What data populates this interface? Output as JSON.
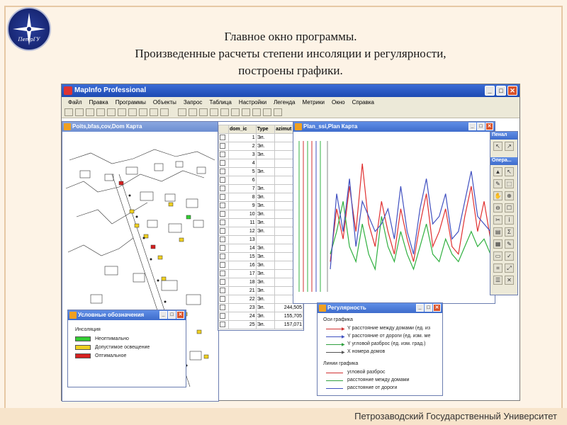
{
  "slide": {
    "title_line1": "Главное окно программы.",
    "title_line2": "Произведенные расчеты степени инсоляции и регулярности,",
    "title_line3": "построены графики.",
    "footer": "Петрозаводский Государственный Университет",
    "logo_text": "ПетрГУ"
  },
  "app": {
    "title": "MapInfo Professional",
    "menu": [
      "Файл",
      "Правка",
      "Программы",
      "Объекты",
      "Запрос",
      "Таблица",
      "Настройки",
      "Легенда",
      "Метрики",
      "Окно",
      "Справка"
    ]
  },
  "map_window": {
    "title": "Poits,bfas,cov,Dom Карта"
  },
  "table_window": {
    "columns": [
      "dom_ic",
      "Type",
      "azimut"
    ],
    "rows": [
      {
        "id": "1",
        "type": "Эл.",
        "azimut": "25"
      },
      {
        "id": "2",
        "type": "Эл.",
        "azimut": "15"
      },
      {
        "id": "3",
        "type": "Эл.",
        "azimut": "1"
      },
      {
        "id": "4",
        "type": "",
        "azimut": ""
      },
      {
        "id": "5",
        "type": "Эл.",
        "azimut": "15"
      },
      {
        "id": "6",
        "type": "",
        "azimut": "15"
      },
      {
        "id": "7",
        "type": "Эл.",
        "azimut": "24"
      },
      {
        "id": "8",
        "type": "Эл.",
        "azimut": "24"
      },
      {
        "id": "9",
        "type": "Эл.",
        "azimut": "24"
      },
      {
        "id": "10",
        "type": "Эл.",
        "azimut": "15"
      },
      {
        "id": "11",
        "type": "Эл.",
        "azimut": "15"
      },
      {
        "id": "12",
        "type": "Эл.",
        "azimut": "15"
      },
      {
        "id": "13",
        "type": "",
        "azimut": "1"
      },
      {
        "id": "14",
        "type": "Эл.",
        "azimut": "25"
      },
      {
        "id": "15",
        "type": "Эл.",
        "azimut": "2"
      },
      {
        "id": "16",
        "type": "Эл.",
        "azimut": "24"
      },
      {
        "id": "17",
        "type": "Эл.",
        "azimut": "91"
      },
      {
        "id": "18",
        "type": "Эл.",
        "azimut": "24"
      },
      {
        "id": "21",
        "type": "Эл.",
        "azimut": "17"
      },
      {
        "id": "22",
        "type": "Эл.",
        "azimut": "15"
      },
      {
        "id": "23",
        "type": "Эл.",
        "azimut": "244,505",
        "extra": "Допус"
      },
      {
        "id": "24",
        "type": "Эл.",
        "azimut": "155,705",
        "extra": "Допус"
      },
      {
        "id": "25",
        "type": "Эл.",
        "azimut": "157,071",
        "extra": "Допус"
      }
    ]
  },
  "chart_window": {
    "title": "Plan_ssi,Plan Карта",
    "chart_data": {
      "type": "line",
      "series": [
        {
          "color": "#e03030",
          "values": [
            20,
            55,
            35,
            70,
            40,
            85,
            45,
            30,
            60,
            40,
            25,
            55,
            35,
            20,
            45,
            65,
            30,
            40,
            55,
            30,
            25,
            50,
            70,
            40,
            60,
            35
          ]
        },
        {
          "color": "#30b040",
          "values": [
            25,
            40,
            60,
            30,
            20,
            45,
            25,
            15,
            50,
            30,
            20,
            40,
            25,
            15,
            30,
            45,
            25,
            20,
            35,
            25,
            20,
            30,
            40,
            30,
            35,
            25
          ]
        },
        {
          "color": "#4050c0",
          "values": [
            15,
            65,
            40,
            75,
            30,
            60,
            50,
            40,
            45,
            55,
            35,
            70,
            40,
            25,
            55,
            75,
            45,
            50,
            65,
            35,
            40,
            60,
            80,
            50,
            45,
            40
          ]
        }
      ]
    }
  },
  "legend_window": {
    "title": "Условные обозначения",
    "heading": "Инсоляция",
    "items": [
      {
        "label": "Неоптимально",
        "color": "#33cc33"
      },
      {
        "label": "Допустимое освещение",
        "color": "#f0d020"
      },
      {
        "label": "Оптимальное",
        "color": "#d62020"
      }
    ]
  },
  "reg_window": {
    "title": "Регулярность",
    "axes_heading": "Оси графика",
    "axes": [
      {
        "label": "Y расстояние между домами (ед. из",
        "color": "#d03030"
      },
      {
        "label": "Y расстояние от дороги (ед. изм. ме",
        "color": "#4050c0"
      },
      {
        "label": "Y угловой разброс (ед. изм. град.)",
        "color": "#30a040"
      },
      {
        "label": "X номера домов",
        "color": "#555555"
      }
    ],
    "lines_heading": "Линии графика",
    "lines": [
      {
        "label": "угловой разброс",
        "color": "#d03030"
      },
      {
        "label": "расстояние между домами",
        "color": "#30a040"
      },
      {
        "label": "расстояние от дороги",
        "color": "#4050c0"
      }
    ]
  },
  "tool_windows": {
    "pen": "Пенал",
    "ops": "Опера..."
  }
}
